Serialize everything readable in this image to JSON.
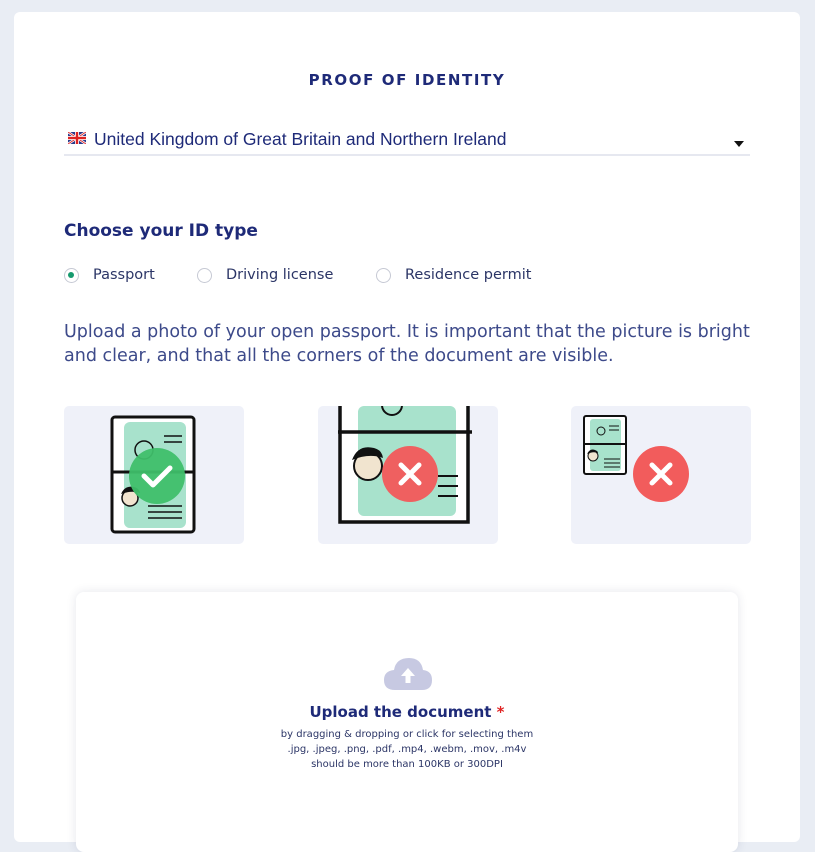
{
  "header": {
    "title": "PROOF OF IDENTITY"
  },
  "country_select": {
    "value": "United Kingdom of Great Britain and Northern Ireland",
    "flag_icon": "uk-flag-icon"
  },
  "id_type": {
    "heading": "Choose your ID type",
    "options": [
      {
        "label": "Passport",
        "selected": true
      },
      {
        "label": "Driving license",
        "selected": false
      },
      {
        "label": "Residence permit",
        "selected": false
      }
    ]
  },
  "instructions": "Upload a photo of your open passport. It is important that the picture is bright and clear, and that all the corners of the document are visible.",
  "examples": [
    {
      "status": "correct",
      "icon": "check-icon"
    },
    {
      "status": "incorrect",
      "icon": "cross-icon"
    },
    {
      "status": "incorrect",
      "icon": "cross-icon"
    }
  ],
  "upload": {
    "title": "Upload the document",
    "required_marker": "*",
    "hint_line1": "by dragging & dropping or click for selecting them",
    "hint_line2": ".jpg, .jpeg, .png, .pdf, .mp4, .webm, .mov, .m4v",
    "hint_line3": "should be more than 100KB or 300DPI",
    "icon": "cloud-upload-icon"
  },
  "colors": {
    "accent": "#1e2a78",
    "success": "#3fbf6a",
    "error": "#f25c5c",
    "document_fill": "#a8e2cc",
    "example_bg": "#eff1f9"
  }
}
